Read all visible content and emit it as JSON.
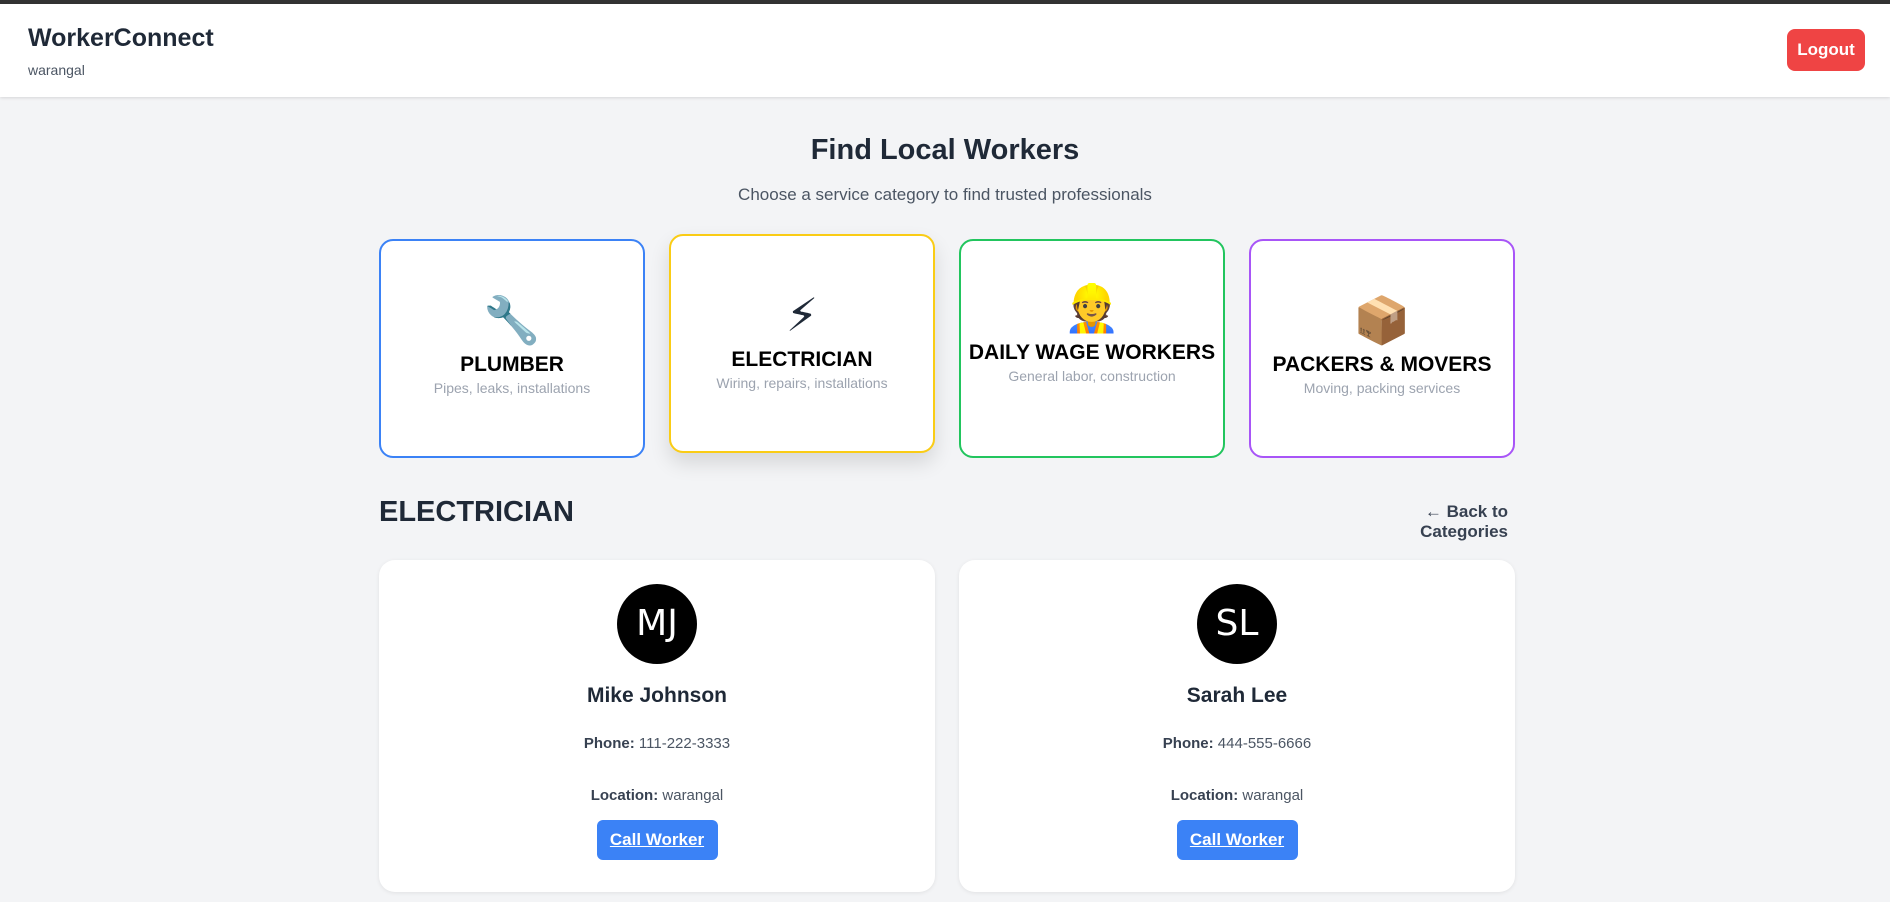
{
  "header": {
    "brand": "WorkerConnect",
    "city": "warangal",
    "logout_label": "Logout",
    "logout_color": "#ef4444"
  },
  "main": {
    "title": "Find Local Workers",
    "subtitle": "Choose a service category to find trusted professionals"
  },
  "categories": [
    {
      "icon": "wrench-icon",
      "emoji": "🔧",
      "name": "PLUMBER",
      "desc": "Pipes, leaks, installations",
      "border_color": "#3b82f6"
    },
    {
      "icon": "lightning-icon",
      "emoji": "⚡",
      "name": "ELECTRICIAN",
      "desc": "Wiring, repairs, installations",
      "border_color": "#facc15",
      "selected": true
    },
    {
      "icon": "construction-worker-icon",
      "emoji": "👷",
      "name": "DAILY WAGE WORKERS",
      "desc": "General labor, construction",
      "border_color": "#22c55e"
    },
    {
      "icon": "package-icon",
      "emoji": "📦",
      "name": "PACKERS & MOVERS",
      "desc": "Moving, packing services",
      "border_color": "#a855f7"
    }
  ],
  "section": {
    "title": "ELECTRICIAN",
    "back_label": "← Back to Categories"
  },
  "workers": [
    {
      "initials": "MJ",
      "name": "Mike Johnson",
      "phone_label": "Phone:",
      "phone": "111-222-3333",
      "location_label": "Location:",
      "location": "warangal",
      "call_label": "Call Worker"
    },
    {
      "initials": "SL",
      "name": "Sarah Lee",
      "phone_label": "Phone:",
      "phone": "444-555-6666",
      "location_label": "Location:",
      "location": "warangal",
      "call_label": "Call Worker"
    }
  ],
  "colors": {
    "accent": "#3b82f6",
    "background": "#f3f4f6"
  }
}
